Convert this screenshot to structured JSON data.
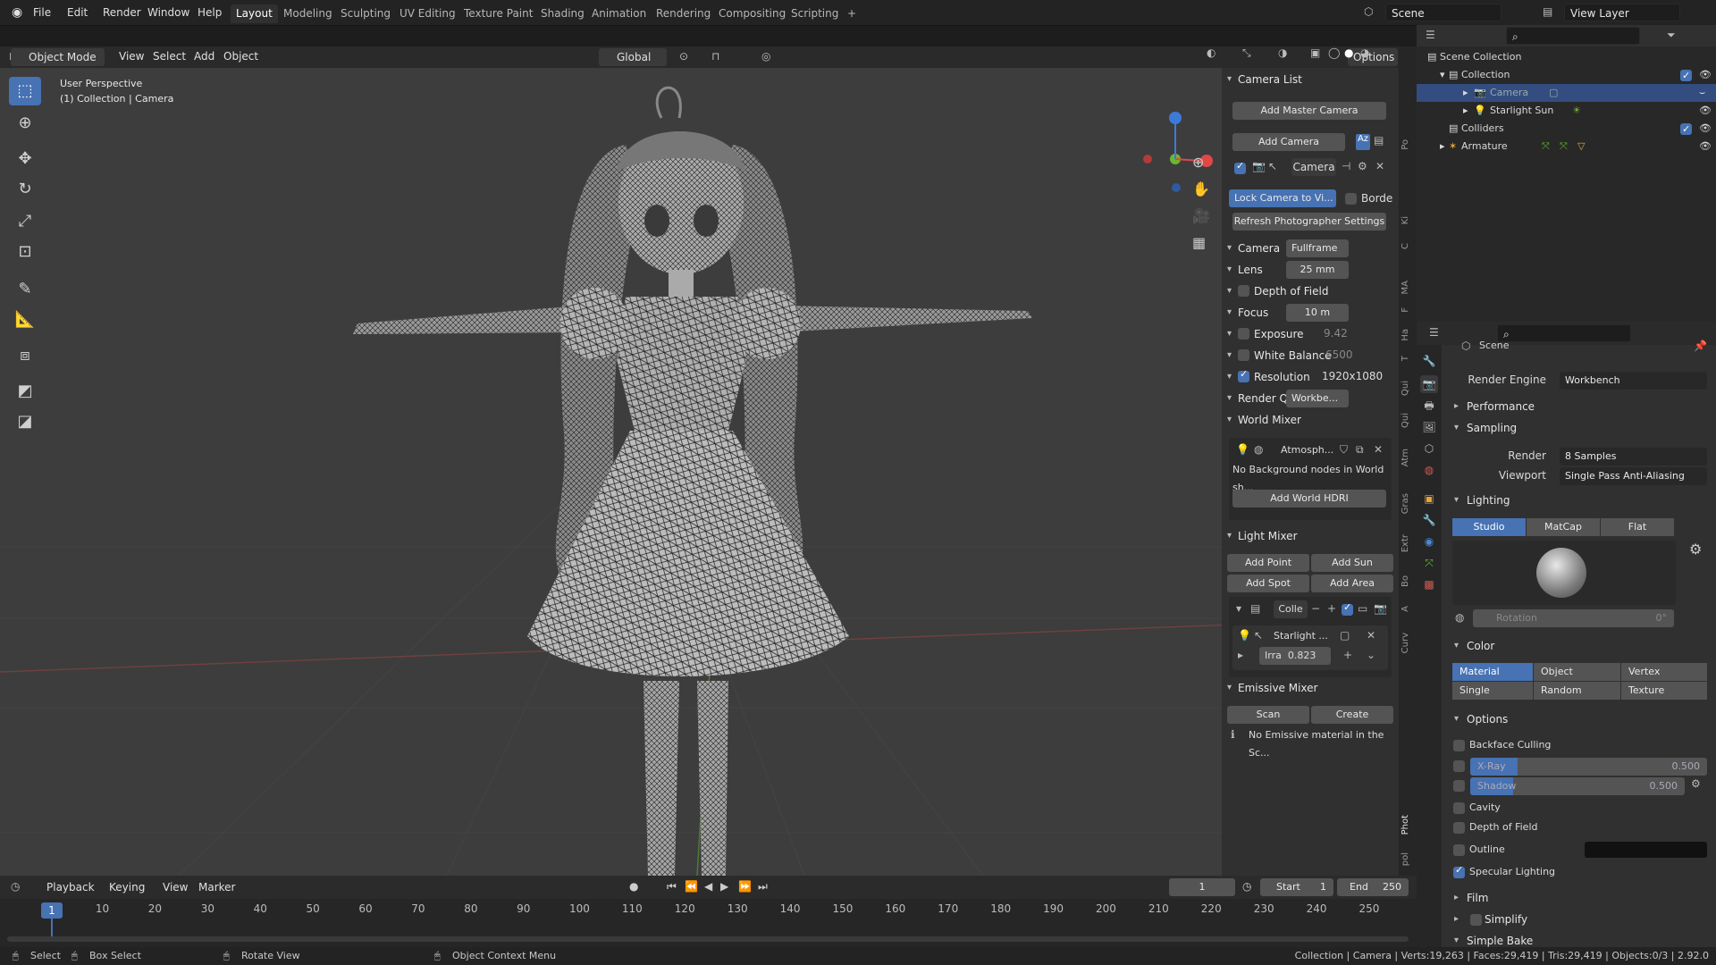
{
  "topbar": {
    "menus": [
      "File",
      "Edit",
      "Render",
      "Window",
      "Help"
    ],
    "workspaces": [
      "Layout",
      "Modeling",
      "Sculpting",
      "UV Editing",
      "Texture Paint",
      "Shading",
      "Animation",
      "Rendering",
      "Compositing",
      "Scripting"
    ],
    "active_workspace": "Layout",
    "plus": "+",
    "scene": "Scene",
    "view_layer": "View Layer"
  },
  "viewport_header": {
    "mode": "Object Mode",
    "menus": [
      "View",
      "Select",
      "Add",
      "Object"
    ],
    "transform": "Global",
    "options": "Options"
  },
  "viewport": {
    "perspective": "User Perspective",
    "context": "(1) Collection | Camera"
  },
  "npanel": {
    "camera_list": "Camera List",
    "add_master_camera": "Add Master Camera",
    "add_camera": "Add Camera",
    "camera_name": "Camera",
    "lock_camera": "Lock Camera to Vi...",
    "border": "Borde",
    "refresh": "Refresh Photographer Settings",
    "camera_row": {
      "label": "Camera",
      "value": "Fullframe"
    },
    "lens": {
      "label": "Lens",
      "value": "25 mm"
    },
    "dof": {
      "label": "Depth of Field"
    },
    "focus": {
      "label": "Focus",
      "value": "10 m"
    },
    "exposure": {
      "label": "Exposure",
      "value": "9.42"
    },
    "white_balance": {
      "label": "White Balance",
      "value": "6500"
    },
    "resolution": {
      "label": "Resolution",
      "value": "1920x1080"
    },
    "render_q": {
      "label": "Render Q",
      "value": "Workbe..."
    },
    "world_mixer": "World Mixer",
    "world_name": "Atmosph...",
    "no_background": "No Background nodes in World sh...",
    "add_world_hdri": "Add World HDRI",
    "light_mixer": "Light Mixer",
    "add_point": "Add Point",
    "add_sun": "Add Sun",
    "add_spot": "Add Spot",
    "add_area": "Add Area",
    "collection": "Colle",
    "light_name": "Starlight ...",
    "irra_label": "Irra",
    "irra_value": "0.823",
    "emissive_mixer": "Emissive Mixer",
    "scan": "Scan",
    "create": "Create",
    "no_emissive": "No Emissive material in the Sc..."
  },
  "ntabs": [
    "Po",
    "Ki",
    "C",
    "MA",
    "F",
    "Ha",
    "T",
    "Qui",
    "Qui",
    "Atm",
    "Gras",
    "Extr",
    "Bo",
    "A",
    "Curv",
    "Phot",
    "pol"
  ],
  "outliner": {
    "scene_collection": "Scene Collection",
    "items": [
      {
        "name": "Collection"
      },
      {
        "name": "Camera"
      },
      {
        "name": "Starlight Sun"
      },
      {
        "name": "Colliders"
      },
      {
        "name": "Armature"
      }
    ]
  },
  "properties": {
    "context": "Scene",
    "render_engine_label": "Render Engine",
    "render_engine": "Workbench",
    "performance": "Performance",
    "sampling": "Sampling",
    "render_label": "Render",
    "render_samples": "8 Samples",
    "viewport_label": "Viewport",
    "viewport_aa": "Single Pass Anti-Aliasing",
    "lighting": "Lighting",
    "lighting_modes": [
      "Studio",
      "MatCap",
      "Flat"
    ],
    "rotation_label": "Rotation",
    "rotation_value": "0°",
    "color": "Color",
    "color_modes_row1": [
      "Material",
      "Object",
      "Vertex"
    ],
    "color_modes_row2": [
      "Single",
      "Random",
      "Texture"
    ],
    "options": "Options",
    "backface": "Backface Culling",
    "xray": "X-Ray",
    "xray_value": "0.500",
    "xray_fraction": 0.5,
    "shadow": "Shadow",
    "shadow_value": "0.500",
    "shadow_fraction": 0.5,
    "cavity": "Cavity",
    "dof": "Depth of Field",
    "outline": "Outline",
    "specular": "Specular Lighting",
    "film": "Film",
    "simplify": "Simplify",
    "simple_bake": "Simple Bake"
  },
  "timeline": {
    "menus": [
      "Playback",
      "Keying",
      "View",
      "Marker"
    ],
    "current_frame": "1",
    "start_label": "Start",
    "start": "1",
    "end_label": "End",
    "end": "250",
    "ticks": [
      "1",
      "10",
      "20",
      "30",
      "40",
      "50",
      "60",
      "70",
      "80",
      "90",
      "100",
      "110",
      "120",
      "130",
      "140",
      "150",
      "160",
      "170",
      "180",
      "190",
      "200",
      "210",
      "220",
      "230",
      "240",
      "250"
    ]
  },
  "statusbar": {
    "select": "Select",
    "box_select": "Box Select",
    "rotate_view": "Rotate View",
    "context_menu": "Object Context Menu",
    "stats": "Collection | Camera | Verts:19,263 | Faces:29,419 | Tris:29,419 | Objects:0/3 | 2.92.0"
  },
  "colors": {
    "accent": "#4772b3",
    "bg": "#3d3d3d"
  }
}
